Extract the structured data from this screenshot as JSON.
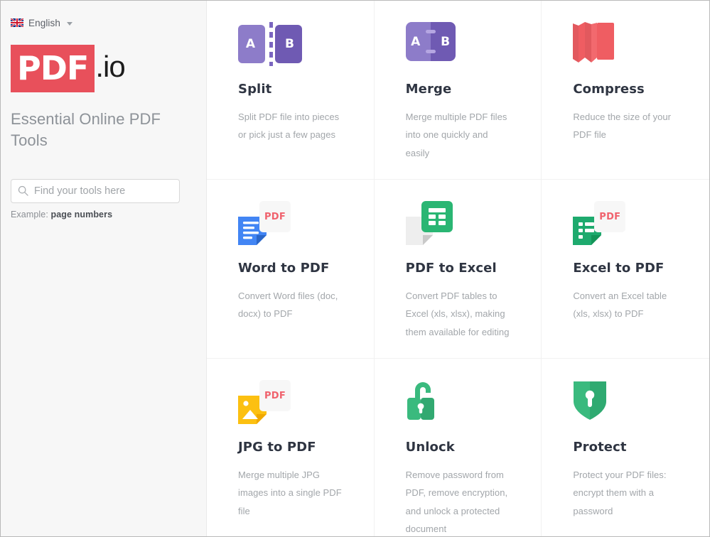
{
  "sidebar": {
    "language": {
      "label": "English",
      "icon": "uk-flag-icon",
      "caret": "chevron-down-icon"
    },
    "logo": {
      "mark": "PDF",
      "suffix": ".io",
      "brand_color": "#e8505b"
    },
    "tagline": "Essential Online PDF Tools",
    "search": {
      "placeholder": "Find your tools here",
      "value": "",
      "icon": "search-icon"
    },
    "example": {
      "prefix": "Example:",
      "term": "page numbers"
    }
  },
  "tools": [
    {
      "id": "split",
      "title": "Split",
      "description": "Split PDF file into pieces or pick just a few pages",
      "icon": "split-icon",
      "icon_labels": {
        "left": "A",
        "right": "B"
      },
      "colors": {
        "light": "#8d7cc9",
        "dark": "#6f5ab3",
        "dash": "#7b66c0"
      }
    },
    {
      "id": "merge",
      "title": "Merge",
      "description": "Merge multiple PDF files into one quickly and easily",
      "icon": "merge-icon",
      "icon_labels": {
        "left": "A",
        "right": "B"
      },
      "colors": {
        "light": "#8d7cc9",
        "dark": "#6f5ab3",
        "bar": "#b5a6e2"
      }
    },
    {
      "id": "compress",
      "title": "Compress",
      "description": "Reduce the size of your PDF file",
      "icon": "compress-icon",
      "colors": {
        "base": "#ef5d62",
        "shade": "#e2595e"
      }
    },
    {
      "id": "word-to-pdf",
      "title": "Word to PDF",
      "description": "Convert Word files (doc, docx) to PDF",
      "icon": "word-to-pdf-icon",
      "badge_text": "PDF",
      "colors": {
        "doc": "#4285f4",
        "fold": "#2a66c8",
        "badge_text": "#f0626d",
        "badge_bg": "#f7f7f7"
      }
    },
    {
      "id": "pdf-to-excel",
      "title": "PDF to Excel",
      "description": "Convert PDF tables to Excel (xls, xlsx), making them available for editing",
      "icon": "pdf-to-excel-icon",
      "colors": {
        "doc": "#eeeeee",
        "fold": "#c9c9c9",
        "sheet": "#2ab673"
      }
    },
    {
      "id": "excel-to-pdf",
      "title": "Excel to PDF",
      "description": "Convert an Excel table (xls, xlsx) to PDF",
      "icon": "excel-to-pdf-icon",
      "badge_text": "PDF",
      "colors": {
        "doc": "#1eaa6e",
        "fold": "#149458",
        "badge_text": "#f0626d",
        "badge_bg": "#f7f7f7"
      }
    },
    {
      "id": "jpg-to-pdf",
      "title": "JPG to PDF",
      "description": "Merge multiple JPG images into a single PDF file",
      "icon": "jpg-to-pdf-icon",
      "badge_text": "PDF",
      "colors": {
        "doc": "#fcc011",
        "fold": "#f0a800",
        "badge_text": "#f0626d",
        "badge_bg": "#f7f7f7"
      }
    },
    {
      "id": "unlock",
      "title": "Unlock",
      "description": "Remove password from PDF, remove encryption, and unlock a protected document",
      "icon": "open-padlock-icon",
      "colors": {
        "body": "#3aba7e",
        "shade": "#32a971"
      }
    },
    {
      "id": "protect",
      "title": "Protect",
      "description": "Protect your PDF files: encrypt them with a password",
      "icon": "shield-key-icon",
      "colors": {
        "body": "#3aba7e",
        "shade": "#2faa71"
      }
    }
  ]
}
